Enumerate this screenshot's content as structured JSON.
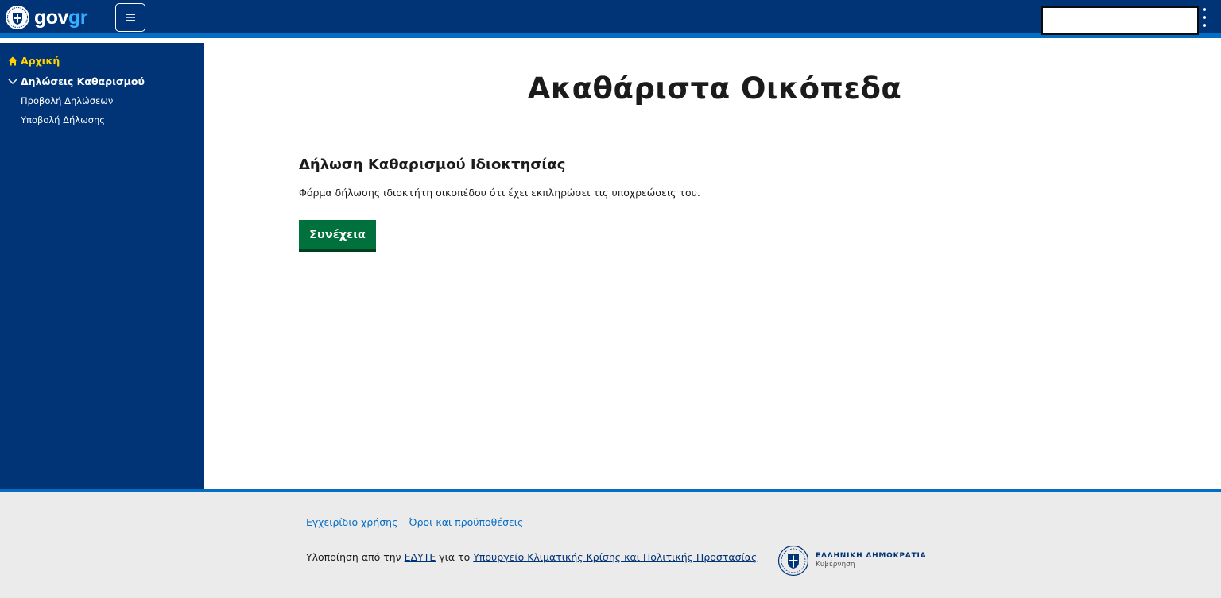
{
  "header": {
    "logo_gov": "gov",
    "logo_gr": "gr",
    "menu_icon": "hamburger-icon",
    "more_icon": "kebab-icon"
  },
  "sidebar": {
    "home": {
      "label": "Αρχική",
      "icon": "home-icon"
    },
    "group": {
      "label": "Δηλώσεις Καθαρισμού",
      "icon": "chevron-down-icon"
    },
    "items": [
      {
        "label": "Προβολή Δηλώσεων"
      },
      {
        "label": "Υποβολή Δήλωσης"
      }
    ]
  },
  "main": {
    "title": "Ακαθάριστα Οικόπεδα",
    "section_title": "Δήλωση Καθαρισμού Ιδιοκτησίας",
    "section_desc": "Φόρμα δήλωσης ιδιοκτήτη οικοπέδου ότι έχει εκπληρώσει τις υποχρεώσεις του.",
    "continue_label": "Συνέχεια"
  },
  "footer": {
    "links": [
      "Εγχειρίδιο χρήσης",
      "Όροι και προϋποθέσεις"
    ],
    "credit_prefix": "Υλοποίηση από την ",
    "credit_org": "ΕΔΥΤΕ",
    "credit_middle": " για το ",
    "credit_ministry": "Υπουργείο Κλιματικής Κρίσης και Πολιτικής Προστασίας",
    "gov_line1": "ΕΛΛΗΝΙΚΗ ΔΗΜΟΚΡΑΤΙΑ",
    "gov_line2": "Κυβέρνηση"
  },
  "colors": {
    "header_bg": "#003476",
    "accent_blue": "#046ec5",
    "nav_active": "#ffd200",
    "button_green": "#00703c",
    "footer_bg": "#ebebeb"
  }
}
